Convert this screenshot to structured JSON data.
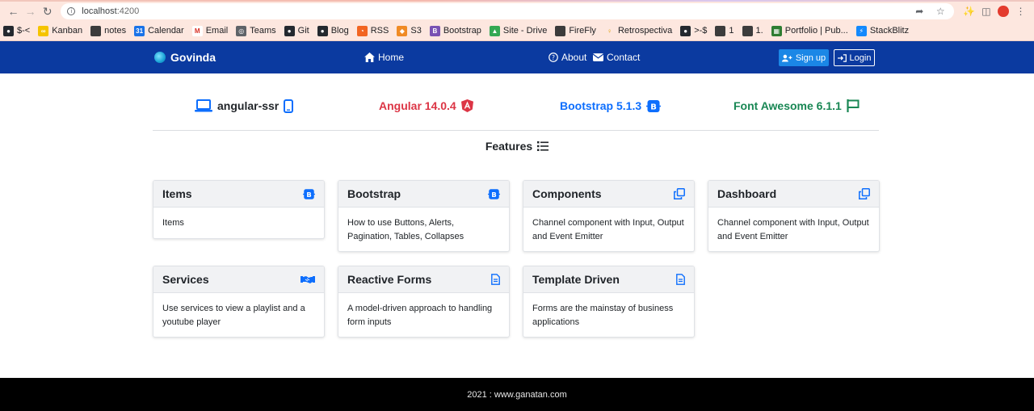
{
  "browser": {
    "url_host": "localhost",
    "url_port": ":4200",
    "bookmarks": [
      {
        "label": "$-<",
        "icon": "github-icon"
      },
      {
        "label": "Kanban",
        "icon": "kanban-icon"
      },
      {
        "label": "notes",
        "icon": "folder-icon"
      },
      {
        "label": "Calendar",
        "icon": "calendar-icon"
      },
      {
        "label": "Email",
        "icon": "gmail-icon"
      },
      {
        "label": "Teams",
        "icon": "globe-icon"
      },
      {
        "label": "Git",
        "icon": "github-icon"
      },
      {
        "label": "Blog",
        "icon": "github-icon"
      },
      {
        "label": "RSS",
        "icon": "rss-icon"
      },
      {
        "label": "S3",
        "icon": "aws-icon"
      },
      {
        "label": "Bootstrap",
        "icon": "bootstrap-icon"
      },
      {
        "label": "Site - Drive",
        "icon": "drive-icon"
      },
      {
        "label": "FireFly",
        "icon": "folder-icon"
      },
      {
        "label": "Retrospectiva",
        "icon": "lightbulb-icon"
      },
      {
        "label": ">-$",
        "icon": "github-icon"
      },
      {
        "label": "1",
        "icon": "folder-icon"
      },
      {
        "label": "1.",
        "icon": "folder-icon"
      },
      {
        "label": "Portfolio | Pub...",
        "icon": "portfolio-icon"
      },
      {
        "label": "StackBlitz",
        "icon": "stackblitz-icon"
      }
    ]
  },
  "navbar": {
    "brand": "Govinda",
    "home": "Home",
    "about": "About",
    "contact": "Contact",
    "signup": "Sign up",
    "login": "Login",
    "color": "#0b3aa0"
  },
  "tech": [
    {
      "label": "angular-ssr",
      "color": "#212529",
      "icon": "laptop-icon"
    },
    {
      "label": "Angular 14.0.4",
      "color": "#dc3545",
      "icon": "angular-icon"
    },
    {
      "label": "Bootstrap 5.1.3",
      "color": "#0d6efd",
      "icon": "bootstrap-icon"
    },
    {
      "label": "Font Awesome 6.1.1",
      "color": "#198754",
      "icon": "flag-icon"
    }
  ],
  "features_title": "Features",
  "cards": [
    {
      "title": "Items",
      "body": "Items",
      "icon": "bootstrap-icon"
    },
    {
      "title": "Bootstrap",
      "body": "How to use Buttons, Alerts, Pagination, Tables, Collapses",
      "icon": "bootstrap-icon"
    },
    {
      "title": "Components",
      "body": "Channel component with Input, Output and Event Emitter",
      "icon": "clone-icon"
    },
    {
      "title": "Dashboard",
      "body": "Channel component with Input, Output and Event Emitter",
      "icon": "clone-icon"
    },
    {
      "title": "Services",
      "body": "Use services to view a playlist and a youtube player",
      "icon": "handshake-icon"
    },
    {
      "title": "Reactive Forms",
      "body": "A model-driven approach to handling form inputs",
      "icon": "file-icon"
    },
    {
      "title": "Template Driven",
      "body": "Forms are the mainstay of business applications",
      "icon": "file-icon"
    }
  ],
  "footer": "2021 : www.ganatan.com",
  "colors": {
    "accent": "#1a73e8",
    "footer_bg": "#000000"
  }
}
